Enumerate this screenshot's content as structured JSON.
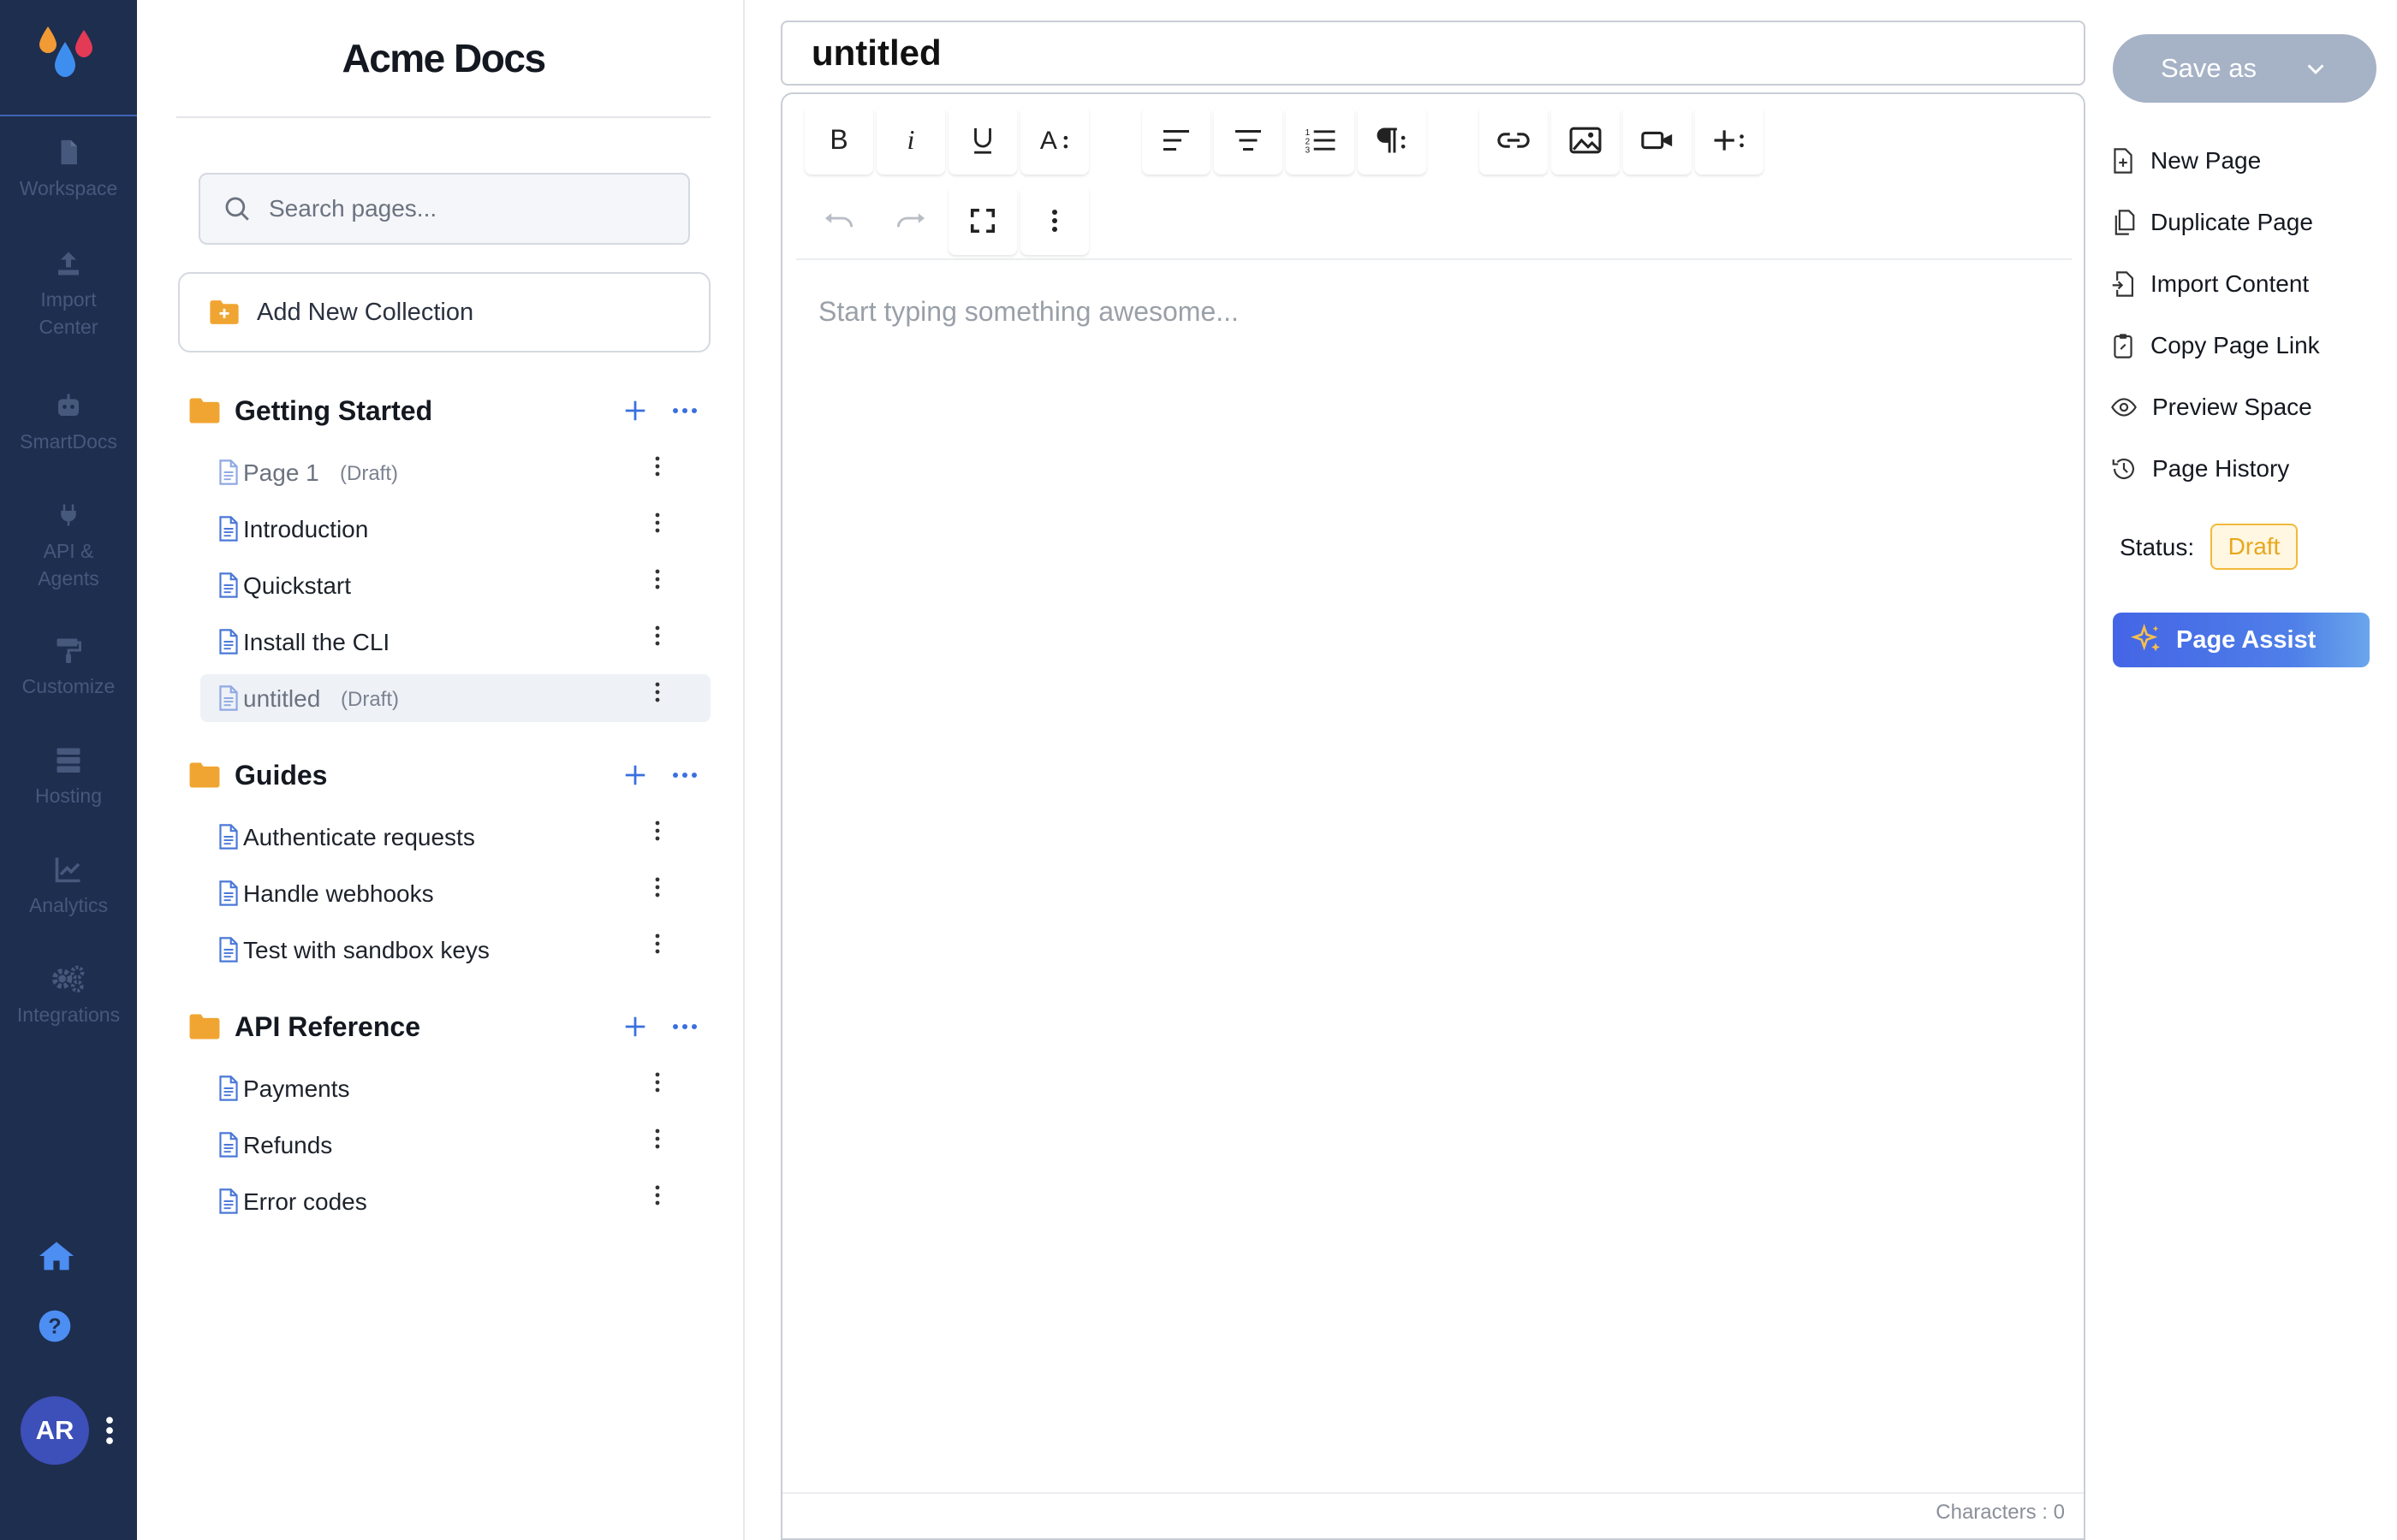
{
  "nav": {
    "items": [
      {
        "label": "Workspace",
        "icon": "file-icon"
      },
      {
        "label": "Import Center",
        "icon": "upload-icon"
      },
      {
        "label": "SmartDocs",
        "icon": "robot-icon"
      },
      {
        "label": "API & Agents",
        "icon": "plug-icon"
      },
      {
        "label": "Customize",
        "icon": "paint-roller-icon"
      },
      {
        "label": "Hosting",
        "icon": "server-icon"
      },
      {
        "label": "Analytics",
        "icon": "chart-line-icon"
      },
      {
        "label": "Integrations",
        "icon": "gears-icon"
      }
    ],
    "avatar_initials": "AR"
  },
  "sidebar": {
    "brand": "Acme Docs",
    "search_placeholder": "Search pages...",
    "add_collection_label": "Add New Collection",
    "collections": [
      {
        "title": "Getting Started",
        "pages": [
          {
            "label": "Page 1",
            "tag": "(Draft)"
          },
          {
            "label": "Introduction",
            "tag": ""
          },
          {
            "label": "Quickstart",
            "tag": ""
          },
          {
            "label": "Install the CLI",
            "tag": ""
          },
          {
            "label": "untitled",
            "tag": "(Draft)"
          }
        ]
      },
      {
        "title": "Guides",
        "pages": [
          {
            "label": "Authenticate requests",
            "tag": ""
          },
          {
            "label": "Handle webhooks",
            "tag": ""
          },
          {
            "label": "Test with sandbox keys",
            "tag": ""
          }
        ]
      },
      {
        "title": "API Reference",
        "pages": [
          {
            "label": "Payments",
            "tag": ""
          },
          {
            "label": "Refunds",
            "tag": ""
          },
          {
            "label": "Error codes",
            "tag": ""
          }
        ]
      }
    ]
  },
  "editor": {
    "title": "untitled",
    "placeholder": "Start typing something awesome...",
    "char_count": "Characters : 0"
  },
  "right_panel": {
    "save_label": "Save as",
    "actions": [
      {
        "label": "New Page",
        "icon": "file-plus-icon"
      },
      {
        "label": "Duplicate Page",
        "icon": "copy-icon"
      },
      {
        "label": "Import Content",
        "icon": "file-import-icon"
      },
      {
        "label": "Copy Page Link",
        "icon": "clipboard-link-icon"
      },
      {
        "label": "Preview Space",
        "icon": "eye-icon"
      },
      {
        "label": "Page History",
        "icon": "history-icon"
      }
    ],
    "status_label": "Status:",
    "status_value": "Draft",
    "assist_label": "Page Assist"
  },
  "colors": {
    "rail_bg": "#1e2e4f",
    "accent_blue": "#3f63b5",
    "folder_orange": "#f0a532",
    "draft_yellow": "#f3b93a",
    "assist_gradient_start": "#4465e6"
  }
}
